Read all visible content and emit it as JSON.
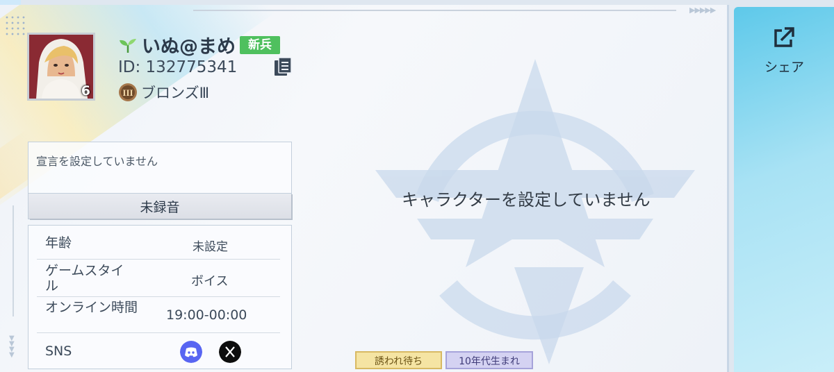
{
  "profile": {
    "name": "いぬ@まめ",
    "rank_badge": "新兵",
    "id_text": "ID: 132775341",
    "tier": "ブロンズⅢ",
    "avatar_level": "6"
  },
  "declaration": {
    "text": "宣言を設定していません",
    "record_button": "未録音"
  },
  "info": {
    "rows": [
      {
        "key": "年齢",
        "value": "未設定"
      },
      {
        "key": "ゲームスタイル",
        "value": "ボイス"
      },
      {
        "key": "オンライン時間",
        "value": "19:00-00:00"
      },
      {
        "key": "SNS",
        "value": ""
      }
    ]
  },
  "character": {
    "empty_text": "キャラクターを設定していません"
  },
  "tags": {
    "waiting": "誘われ待ち",
    "era": "10年代生まれ"
  },
  "share": {
    "label": "シェア"
  },
  "colors": {
    "rank_badge": "#4fc05e",
    "share_panel": "#5ec9ea",
    "tag_waiting": "#f5e4a3",
    "tag_era": "#d4d2f2",
    "discord": "#5865f2"
  },
  "icons": {
    "sprout": "sprout-icon",
    "copy": "copy-icon",
    "tier": "bronze-tier-icon",
    "discord": "discord-icon",
    "x": "x-icon",
    "share": "share-icon"
  }
}
